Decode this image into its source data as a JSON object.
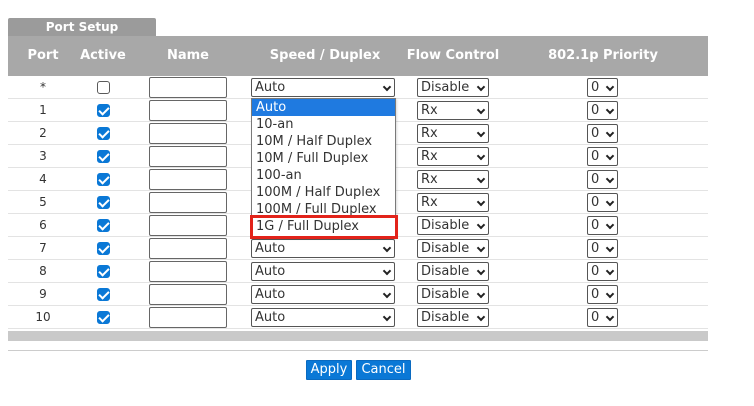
{
  "panel": {
    "title": "Port Setup"
  },
  "columns": {
    "port": "Port",
    "active": "Active",
    "name": "Name",
    "speed": "Speed / Duplex",
    "flow": "Flow Control",
    "priority": "802.1p Priority"
  },
  "rows": [
    {
      "port": "*",
      "active": false,
      "name": "",
      "speed": "Auto",
      "flow": "Disable",
      "priority": "0"
    },
    {
      "port": "1",
      "active": true,
      "name": "",
      "speed": "Auto",
      "flow": "Rx",
      "priority": "0"
    },
    {
      "port": "2",
      "active": true,
      "name": "",
      "speed": "Auto",
      "flow": "Rx",
      "priority": "0"
    },
    {
      "port": "3",
      "active": true,
      "name": "",
      "speed": "Auto",
      "flow": "Rx",
      "priority": "0"
    },
    {
      "port": "4",
      "active": true,
      "name": "",
      "speed": "Auto",
      "flow": "Rx",
      "priority": "0"
    },
    {
      "port": "5",
      "active": true,
      "name": "",
      "speed": "Auto",
      "flow": "Rx",
      "priority": "0"
    },
    {
      "port": "6",
      "active": true,
      "name": "",
      "speed": "Auto",
      "flow": "Disable",
      "priority": "0"
    },
    {
      "port": "7",
      "active": true,
      "name": "",
      "speed": "Auto",
      "flow": "Disable",
      "priority": "0"
    },
    {
      "port": "8",
      "active": true,
      "name": "",
      "speed": "Auto",
      "flow": "Disable",
      "priority": "0"
    },
    {
      "port": "9",
      "active": true,
      "name": "",
      "speed": "Auto",
      "flow": "Disable",
      "priority": "0"
    },
    {
      "port": "10",
      "active": true,
      "name": "",
      "speed": "Auto",
      "flow": "Disable",
      "priority": "0"
    }
  ],
  "speed_dropdown": {
    "options": [
      "Auto",
      "10-an",
      "10M / Half Duplex",
      "10M / Full Duplex",
      "100-an",
      "100M / Half Duplex",
      "100M / Full Duplex",
      "1G / Full Duplex"
    ],
    "selected_index": 0,
    "highlighted_option": "1G / Full Duplex"
  },
  "buttons": {
    "apply": "Apply",
    "cancel": "Cancel"
  },
  "colors": {
    "header_bg": "#a8a8a8",
    "tab_bg": "#9b9b9b",
    "accent_blue": "#0a78d6",
    "highlight_red": "#e2231a"
  },
  "icons": {
    "select_arrow": "chevron-down-icon",
    "checkbox_check": "check-icon"
  }
}
